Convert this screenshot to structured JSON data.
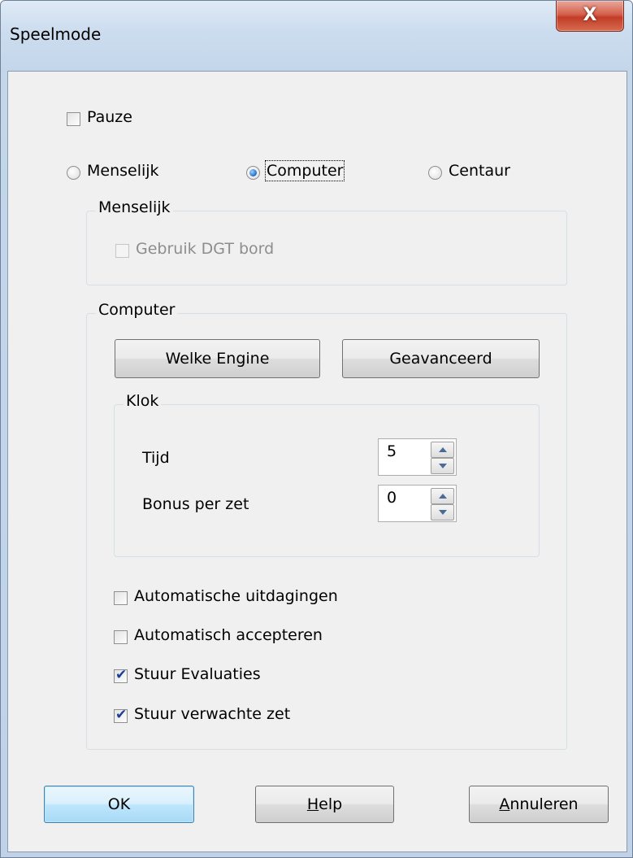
{
  "window": {
    "title": "Speelmode",
    "close_glyph": "X"
  },
  "pause": {
    "label": "Pauze",
    "checked": false
  },
  "modes": [
    {
      "label": "Menselijk",
      "selected": false
    },
    {
      "label": "Computer",
      "selected": true
    },
    {
      "label": "Centaur",
      "selected": false
    }
  ],
  "human_group": {
    "title": "Menselijk",
    "dgt": {
      "label": "Gebruik DGT bord",
      "checked": false,
      "enabled": false
    }
  },
  "computer_group": {
    "title": "Computer",
    "engine_button": "Welke Engine",
    "advanced_button": "Geavanceerd",
    "clock": {
      "title": "Klok",
      "time_label": "Tijd",
      "time_value": "5",
      "bonus_label": "Bonus per zet",
      "bonus_value": "0"
    },
    "options": [
      {
        "label": "Automatische uitdagingen",
        "checked": false
      },
      {
        "label": "Automatisch accepteren",
        "checked": false
      },
      {
        "label": "Stuur Evaluaties",
        "checked": true
      },
      {
        "label": "Stuur verwachte zet",
        "checked": true
      }
    ]
  },
  "footer": {
    "ok": "OK",
    "help_mnemonic": "H",
    "help_rest": "elp",
    "cancel_mnemonic": "A",
    "cancel_rest": "nnuleren"
  },
  "icons": {
    "spin_up": "arrow-up-icon",
    "spin_down": "arrow-down-icon",
    "close": "close-icon"
  },
  "colors": {
    "accent": "#3c7fb1",
    "close": "#c23d27",
    "frame": "#c3d6ea"
  }
}
